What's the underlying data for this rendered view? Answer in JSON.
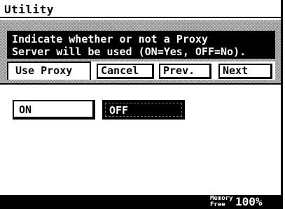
{
  "window": {
    "title": "Utility"
  },
  "message": {
    "line1": "Indicate whether or not a Proxy",
    "line2": "Server will be used (ON=Yes, OFF=No)."
  },
  "tab": {
    "label": "Use Proxy"
  },
  "buttons": {
    "cancel": "Cancel",
    "prev": "Prev.",
    "next": "Next"
  },
  "options": {
    "on": "ON",
    "off": "OFF",
    "selected": "OFF"
  },
  "status": {
    "memory_label_line1": "Memory",
    "memory_label_line2": "Free",
    "memory_value": "100%"
  },
  "colors": {
    "background": "#ffffff",
    "ink": "#000000",
    "hatch": "#8a8a8a"
  }
}
